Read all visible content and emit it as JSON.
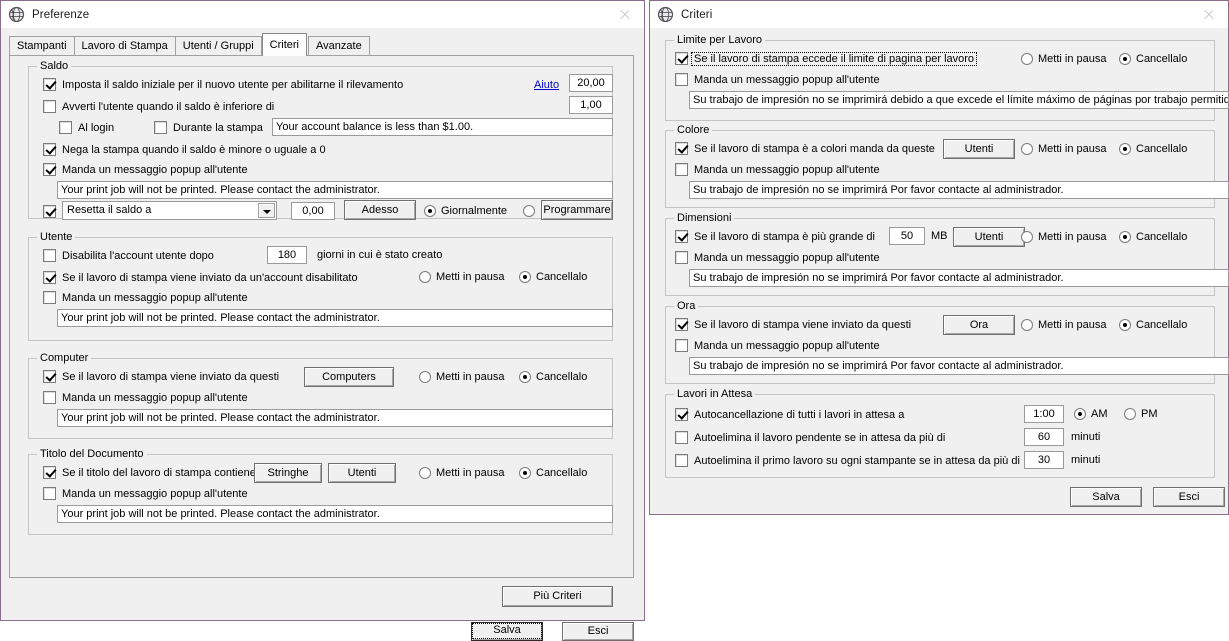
{
  "preferenze": {
    "title": "Preferenze",
    "icon": "globe-icon",
    "close": "close-icon",
    "tabs": [
      {
        "label": "Stampanti",
        "active": false
      },
      {
        "label": "Lavoro di Stampa",
        "active": false
      },
      {
        "label": "Utenti / Gruppi",
        "active": false
      },
      {
        "label": "Criteri",
        "active": true
      },
      {
        "label": "Avanzate",
        "active": false
      }
    ],
    "saldo": {
      "legend": "Saldo",
      "imposta_label": "Imposta il saldo iniziale per il nuovo utente per abilitarne il rilevamento",
      "aiuto_link": "Aiuto",
      "imposta_value": "20,00",
      "avverti_label": "Avverti l'utente quando il saldo è inferiore di",
      "avverti_value": "1,00",
      "al_login_label": "Al login",
      "durante_label": "Durante la stampa",
      "warn_message": "Your account balance is less than $1.00.",
      "nega_label": "Nega la stampa quando il saldo è minore o uguale a 0",
      "popup_label": "Manda un messaggio popup all'utente",
      "popup_message": "Your print job will not be printed. Please contact the administrator.",
      "resetta_combo": "Resetta il saldo a",
      "resetta_value": "0,00",
      "adesso_button": "Adesso",
      "giornalmente_label": "Giornalmente",
      "programmare_button": "Programmare"
    },
    "utente": {
      "legend": "Utente",
      "disabilita_label": "Disabilita l'account utente dopo",
      "disabilita_value": "180",
      "giorni_label": "giorni in cui è stato creato",
      "lavoro_label": "Se il lavoro di stampa viene inviato da un'account disabilitato",
      "pausa_label": "Metti in pausa",
      "cancella_label": "Cancellalo",
      "popup_label": "Manda un messaggio popup all'utente",
      "popup_message": "Your print job will not be printed. Please contact the administrator."
    },
    "computer": {
      "legend": "Computer",
      "lavoro_label": "Se il lavoro di stampa viene inviato da questi",
      "computers_button": "Computers",
      "pausa_label": "Metti in pausa",
      "cancella_label": "Cancellalo",
      "popup_label": "Manda un messaggio popup all'utente",
      "popup_message": "Your print job will not be printed. Please contact the administrator."
    },
    "titolo": {
      "legend": "Titolo del Documento",
      "titolo_label": "Se il titolo del lavoro di stampa contiene",
      "stringhe_button": "Stringhe",
      "utenti_button": "Utenti",
      "pausa_label": "Metti in pausa",
      "cancella_label": "Cancellalo",
      "popup_label": "Manda un messaggio popup all'utente",
      "popup_message": "Your print job will not be printed. Please contact the administrator."
    },
    "piu_criteri_button": "Più Criteri",
    "salva_button": "Salva",
    "esci_button": "Esci"
  },
  "criteri": {
    "title": "Criteri",
    "icon": "globe-icon",
    "close": "close-icon",
    "limite": {
      "legend": "Limite per Lavoro",
      "eccede_label": "Se il lavoro di stampa eccede il limite di pagina per lavoro",
      "pausa_label": "Metti in pausa",
      "cancella_label": "Cancellalo",
      "popup_label": "Manda un messaggio popup all'utente",
      "popup_message": "Su trabajo de impresión no se imprimirá debido a que excede el límite máximo de páginas por trabajo permitid"
    },
    "colore": {
      "legend": "Colore",
      "colori_label": "Se il lavoro di stampa è a colori manda da queste",
      "utenti_button": "Utenti",
      "pausa_label": "Metti in pausa",
      "cancella_label": "Cancellalo",
      "popup_label": "Manda un messaggio popup all'utente",
      "popup_message": "Su trabajo de impresión no se imprimirá Por favor contacte al administrador."
    },
    "dimensioni": {
      "legend": "Dimensioni",
      "grande_label": "Se il lavoro di stampa è più grande di",
      "size_value": "50",
      "unit_label": "MB",
      "utenti_button": "Utenti",
      "pausa_label": "Metti in pausa",
      "cancella_label": "Cancellalo",
      "popup_label": "Manda un messaggio popup all'utente",
      "popup_message": "Su trabajo de impresión no se imprimirá Por favor contacte al administrador."
    },
    "ora": {
      "legend": "Ora",
      "inviato_label": "Se il lavoro di stampa viene inviato da questi",
      "ora_button": "Ora",
      "pausa_label": "Metti in pausa",
      "cancella_label": "Cancellalo",
      "popup_label": "Manda un messaggio popup all'utente",
      "popup_message": "Su trabajo de impresión no se imprimirá Por favor contacte al administrador."
    },
    "attesa": {
      "legend": "Lavori in Attesa",
      "auto_label": "Autocancellazione di tutti i lavori in attesa a",
      "auto_value": "1:00",
      "am_label": "AM",
      "pm_label": "PM",
      "pendente_label": "Autoelimina il lavoro pendente se in attesa da più di",
      "pendente_value": "60",
      "pendente_unit": "minuti",
      "primo_label": "Autoelimina il primo lavoro su ogni stampante se in attesa da più di",
      "primo_value": "30",
      "primo_unit": "minuti"
    },
    "salva_button": "Salva",
    "esci_button": "Esci"
  }
}
